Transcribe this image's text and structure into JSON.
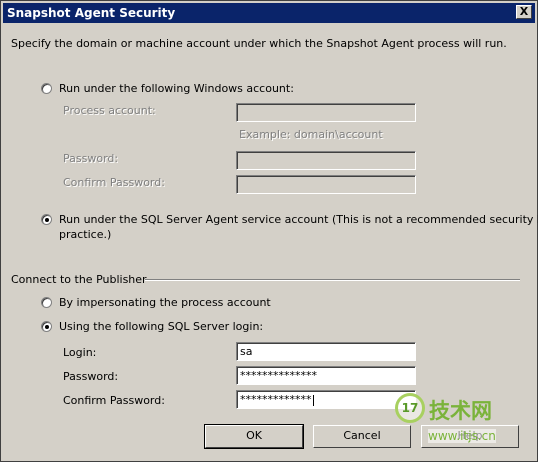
{
  "window": {
    "title": "Snapshot Agent Security",
    "close_glyph": "X"
  },
  "description": "Specify the domain or machine account under which the Snapshot Agent process will run.",
  "agent_account": {
    "option_windows": "Run under the following Windows account:",
    "process_account_label": "Process account:",
    "process_account_value": "",
    "example_text": "Example: domain\\account",
    "password_label": "Password:",
    "password_value": "",
    "confirm_password_label": "Confirm Password:",
    "confirm_password_value": "",
    "option_sql_agent_line1": "Run under the SQL Server Agent service account (This is not a recommended security best",
    "option_sql_agent_line2": "practice.)",
    "selected": "sql_agent"
  },
  "publisher": {
    "section_title": "Connect to the Publisher",
    "option_impersonate": "By impersonating the process account",
    "option_sql_login": "Using the following SQL Server login:",
    "selected": "sql_login",
    "login_label": "Login:",
    "login_value": "sa",
    "password_label": "Password:",
    "password_value": "**************",
    "confirm_password_label": "Confirm Password:",
    "confirm_password_value": "*************"
  },
  "buttons": {
    "ok": "OK",
    "cancel": "Cancel",
    "help": "Help"
  },
  "watermark": {
    "logo_text": "17",
    "site_name": "技术网",
    "url": "www.itjs.cn"
  }
}
